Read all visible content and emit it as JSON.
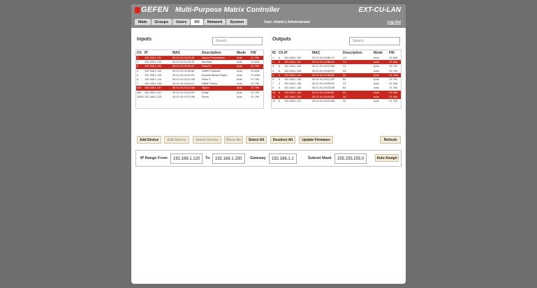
{
  "header": {
    "logo": "GEFEN",
    "title": "Multi-Purpose Matrix Controller",
    "model": "EXT-CU-LAN",
    "user_info": "User: Admin  |  Administrator",
    "logout": "Log Out"
  },
  "tabs": [
    "Main",
    "Groups",
    "Users",
    "I/O",
    "Network",
    "System"
  ],
  "active_tab": "I/O",
  "inputs": {
    "title": "Inputs",
    "search_placeholder": "Search",
    "columns": [
      "Ch",
      "IP",
      "MAC",
      "Description",
      "Mode",
      "FW"
    ],
    "rows": [
      {
        "ch": "1",
        "ip": "192.168.1.121",
        "mac": "00:1C:91:03:21:28",
        "desc": "Dance Presentation",
        "mode": "Auto",
        "fw": "V1.79h",
        "sel": true
      },
      {
        "ch": "2",
        "ip": "192.168.1.120",
        "mac": "00:1C:91:04:30:76",
        "desc": "Wireless",
        "mode": "Auto",
        "fw": "V1.63d",
        "sel": false
      },
      {
        "ch": "3",
        "ip": "192.168.1.122",
        "mac": "00:1C:91:03:21:A7",
        "desc": "DirecTV",
        "mode": "Auto",
        "fw": "V1.79h",
        "sel": true
      },
      {
        "ch": "4",
        "ip": "192.168.1.123",
        "mac": "00:1C:91:04:30:58",
        "desc": "Gefen Products",
        "mode": "Auto",
        "fw": "V1.63d",
        "sel": false
      },
      {
        "ch": "5",
        "ip": "192.168.1.123",
        "mac": "00:1C:91:04:41:03",
        "desc": "Android Media Player",
        "mode": "Auto",
        "fw": "V1.63ta",
        "sel": false
      },
      {
        "ch": "6",
        "ip": "192.168.1.124",
        "mac": "00:1C:91:03:C2:48",
        "desc": "Roku 3",
        "mode": "Auto",
        "fw": "V1.79h",
        "sel": false
      },
      {
        "ch": "7",
        "ip": "192.168.1.126",
        "mac": "00:1C:91:04:31:01",
        "desc": "DBMP Demo",
        "mode": "Auto",
        "fw": "V1.79h",
        "sel": false
      },
      {
        "ch": "400",
        "ip": "192.168.1.127",
        "mac": "00:1C:91:03:C2:68",
        "desc": "Signer",
        "mode": "Auto",
        "fw": "V1.79h",
        "sel": true
      },
      {
        "ch": "530",
        "ip": "192.168.1.121",
        "mac": "00:1C:91:04:41:09",
        "desc": "Dolby",
        "mode": "Auto",
        "fw": "V1.79h",
        "sel": false
      },
      {
        "ch": "15000",
        "ip": "192.168.1.129",
        "mac": "00:1C:91:03:C0:98",
        "desc": "Ronin",
        "mode": "Auto",
        "fw": "V1.79h",
        "sel": false
      }
    ]
  },
  "outputs": {
    "title": "Outputs",
    "search_placeholder": "Search",
    "columns": [
      "ID",
      "Ch",
      "IP",
      "MAC",
      "Description",
      "Mode",
      "FW"
    ],
    "rows": [
      {
        "id": "1",
        "ch": "6",
        "ip": "192.168.1.130",
        "mac": "00:1C:91:03:B8:79",
        "desc": "C3",
        "mode": "Auto",
        "fw": "V1.63d",
        "sel": false
      },
      {
        "id": "2",
        "ch": "6",
        "ip": "192.168.1.131",
        "mac": "00:1C:91:03:B8:A1",
        "desc": "C2",
        "mode": "Auto",
        "fw": "V1.63d",
        "sel": true
      },
      {
        "id": "3",
        "ch": "6",
        "ip": "192.168.1.132",
        "mac": "00:1C:91:03:C0:B3",
        "desc": "C1",
        "mode": "Auto",
        "fw": "V1.79h",
        "sel": false
      },
      {
        "id": "4",
        "ch": "6",
        "ip": "192.168.1.133",
        "mac": "00:1C:91:03:D6:F2",
        "desc": "A2",
        "mode": "Auto",
        "fw": "V1.79h",
        "sel": false
      },
      {
        "id": "5",
        "ch": "6",
        "ip": "192.168.1.134",
        "mac": "00:1C:91:04:46:0E",
        "desc": "A1",
        "mode": "Auto",
        "fw": "V1.70ta",
        "sel": true
      },
      {
        "id": "6",
        "ch": "6",
        "ip": "192.168.1.135",
        "mac": "00:1C:91:03:C4:EF",
        "desc": "B2",
        "mode": "Auto",
        "fw": "V1.79h",
        "sel": false
      },
      {
        "id": "7",
        "ch": "4",
        "ip": "192.168.1.136",
        "mac": "00:1C:91:04:59:E3",
        "desc": "C2",
        "mode": "Auto",
        "fw": "V1.63d",
        "sel": false
      },
      {
        "id": "9",
        "ch": "6",
        "ip": "192.168.1.138",
        "mac": "00:1C:91:03:C6:0E",
        "desc": "B1",
        "mode": "Auto",
        "fw": "V1.79h",
        "sel": false
      },
      {
        "id": "10",
        "ch": "6",
        "ip": "192.168.1.139",
        "mac": "00:1C:91:04:59:36",
        "desc": "D1",
        "mode": "Auto",
        "fw": "V1.63d",
        "sel": true
      },
      {
        "id": "11",
        "ch": "6",
        "ip": "192.168.1.140",
        "mac": "00:1C:91:04:24:EE",
        "desc": "D2",
        "mode": "Auto",
        "fw": "V1.63d",
        "sel": true
      },
      {
        "id": "12",
        "ch": "6",
        "ip": "192.168.1.141",
        "mac": "00:1C:91:03:C6:BD",
        "desc": "D1",
        "mode": "Auto",
        "fw": "V1.79h",
        "sel": false
      }
    ]
  },
  "toolbar": {
    "add_device": "Add Device",
    "edit_device": "Edit Device",
    "delete_device": "Delete Device",
    "show_me": "Show Me",
    "select_all": "Select All",
    "deselect_all": "Deselect All",
    "update_firmware": "Update Firmware",
    "refresh": "Refresh"
  },
  "ip_range": {
    "from_label": "IP Range From",
    "from_value": "192.168.1.120",
    "to_label": "To",
    "to_value": "192.168.1.150",
    "gateway_label": "Gateway",
    "gateway_value": "192.168.1.1",
    "subnet_label": "Subnet Mask",
    "subnet_value": "255.255.255.0",
    "auto_assign": "Auto Assign"
  },
  "colors": {
    "background": "#6e6e6e",
    "header": "#8a8a8a",
    "selected_row": "#c8281e",
    "button": "#f4ecd8",
    "brand": "#e2231a"
  }
}
